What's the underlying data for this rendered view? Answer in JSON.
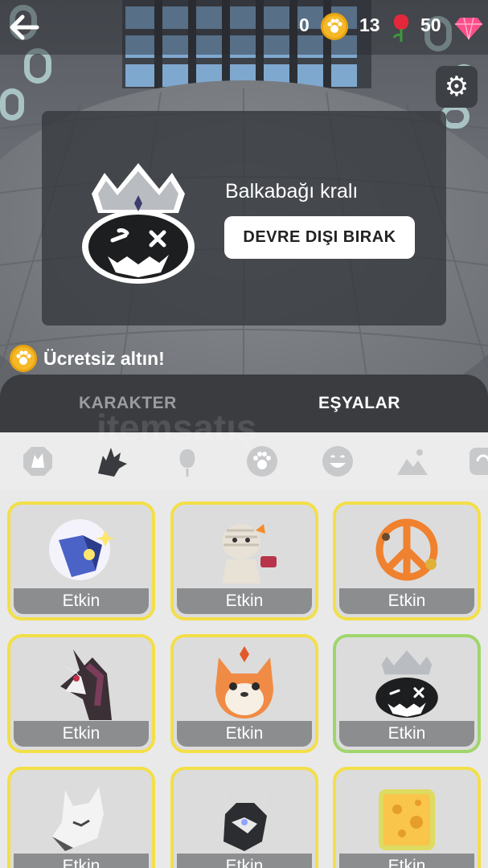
{
  "header": {
    "back_label": "back",
    "paw_coins": "0",
    "roses": "13",
    "gems": "50"
  },
  "equipped": {
    "name": "Balkabağı kralı",
    "disable_button": "DEVRE DIŞI BIRAK"
  },
  "promo": {
    "free_gold": "Ücretsiz altın!"
  },
  "tabs": [
    {
      "label": "KARAKTER"
    },
    {
      "label": "EŞYALAR"
    }
  ],
  "categories": [
    "wolf-badge-icon",
    "wolf-icon",
    "rose-icon",
    "paw-icon",
    "smile-icon",
    "landscape-icon",
    "refresh-icon"
  ],
  "items": [
    {
      "status": "Etkin",
      "icon": "spellbook-icon"
    },
    {
      "status": "Etkin",
      "icon": "mummy-icon"
    },
    {
      "status": "Etkin",
      "icon": "peace-sign-icon"
    },
    {
      "status": "Etkin",
      "icon": "wolf-hood-icon"
    },
    {
      "status": "Etkin",
      "icon": "fox-icon"
    },
    {
      "status": "Etkin",
      "icon": "pumpkin-king-icon"
    },
    {
      "status": "Etkin",
      "icon": "white-wolf-icon"
    },
    {
      "status": "Etkin",
      "icon": "horned-wolf-icon"
    },
    {
      "status": "Etkin",
      "icon": "cheese-icon"
    }
  ],
  "colors": {
    "card_border": "#f3df47",
    "card_active_border": "#9fd66b",
    "coin": "#f5b928",
    "rose": "#e2283a",
    "gem": "#ff4f8a"
  }
}
